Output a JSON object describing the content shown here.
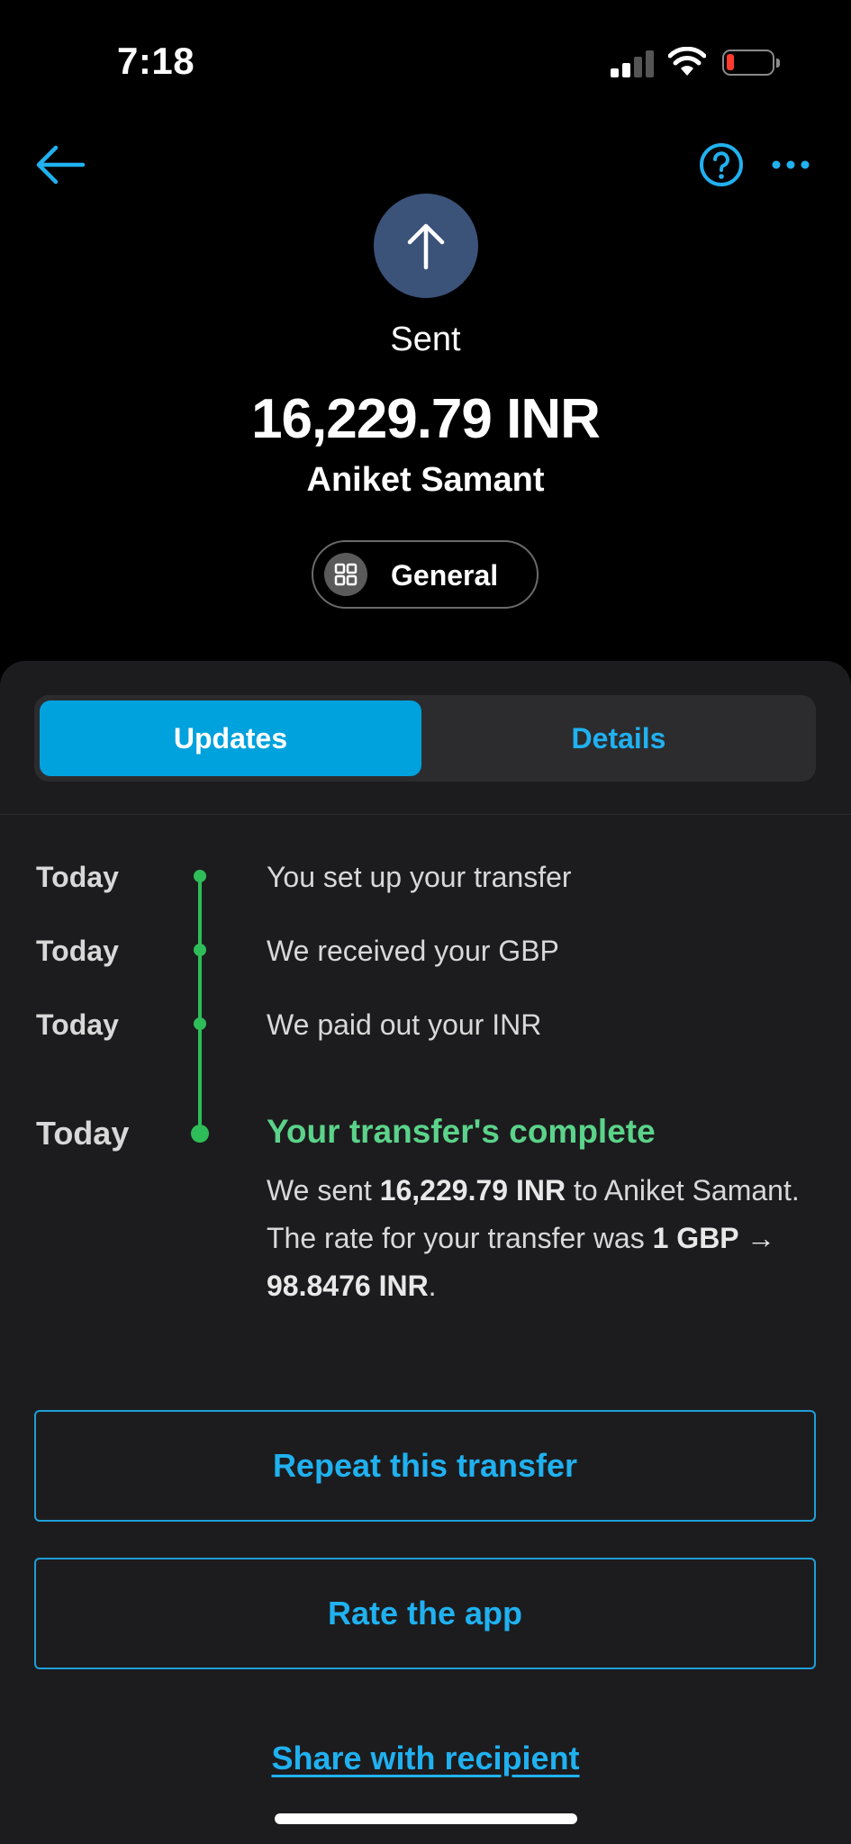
{
  "status_bar": {
    "time": "7:18"
  },
  "nav": {
    "back_icon": "arrow-left-icon",
    "help_icon": "question-circle-icon",
    "more_icon": "more-dots-icon"
  },
  "header": {
    "status_icon": "arrow-up-icon",
    "status": "Sent",
    "amount": "16,229.79 INR",
    "recipient": "Aniket Samant",
    "category": {
      "icon": "grid-icon",
      "label": "General"
    }
  },
  "tabs": {
    "active": "Updates",
    "inactive": "Details"
  },
  "timeline": {
    "items": [
      {
        "date": "Today",
        "text": "You set up your transfer"
      },
      {
        "date": "Today",
        "text": "We received your GBP"
      },
      {
        "date": "Today",
        "text": "We paid out your INR"
      }
    ],
    "final": {
      "date": "Today",
      "title": "Your transfer's complete",
      "body_1": "We sent ",
      "body_amount": "16,229.79 INR",
      "body_2": " to Aniket Samant. The rate for your transfer was ",
      "body_rate": "1 GBP → 98.8476 INR",
      "body_3": "."
    }
  },
  "actions": {
    "repeat": "Repeat this transfer",
    "rate": "Rate the app",
    "share": "Share with recipient"
  },
  "colors": {
    "accent": "#00a2dd",
    "link": "#20b1f0",
    "success": "#2ebd59",
    "sent_circle": "#3b5279"
  }
}
